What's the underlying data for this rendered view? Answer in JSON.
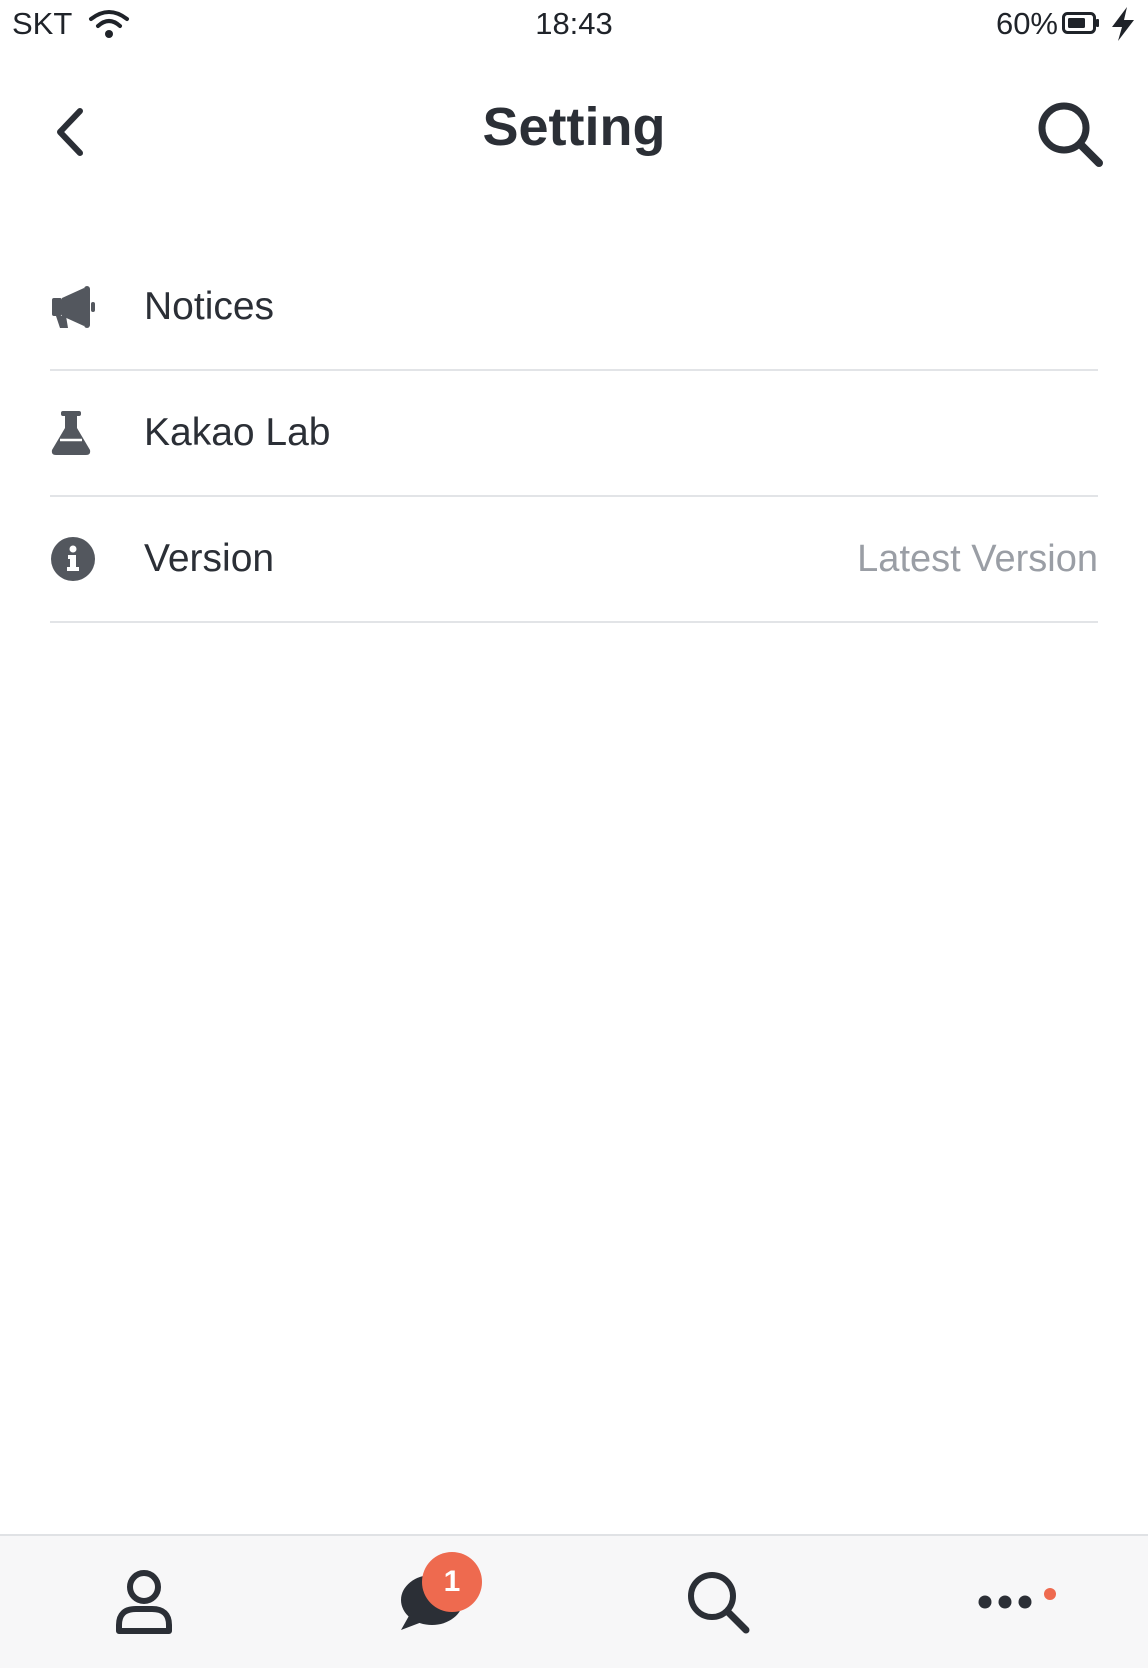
{
  "status_bar": {
    "carrier": "SKT",
    "time": "18:43",
    "battery": "60%"
  },
  "header": {
    "title": "Setting",
    "back_icon": "chevron-left-icon",
    "search_icon": "search-icon"
  },
  "settings": {
    "items": [
      {
        "label": "Notices",
        "icon": "megaphone-icon",
        "value": ""
      },
      {
        "label": "Kakao Lab",
        "icon": "flask-icon",
        "value": ""
      },
      {
        "label": "Version",
        "icon": "info-icon",
        "value": "Latest Version"
      }
    ]
  },
  "tab_bar": {
    "tabs": [
      {
        "name": "friends",
        "icon": "person-icon"
      },
      {
        "name": "chats",
        "icon": "chat-bubble-icon",
        "badge": "1"
      },
      {
        "name": "search",
        "icon": "search-icon"
      },
      {
        "name": "more",
        "icon": "more-dots-icon"
      }
    ]
  },
  "colors": {
    "text": "#2b2f36",
    "secondary_text": "#9a9ea5",
    "divider": "#e2e4e7",
    "badge": "#ee6a4f",
    "tab_bar_bg": "#f7f7f8"
  }
}
